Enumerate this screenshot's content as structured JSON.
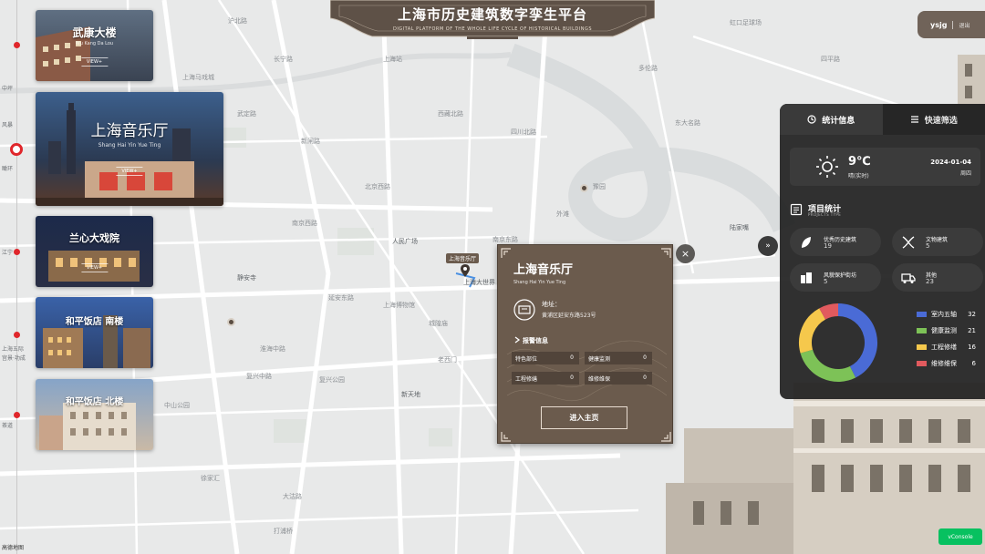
{
  "header": {
    "title": "上海市历史建筑数字孪生平台",
    "subtitle": "DIGITAL PLATFORM OF THE WHOLE LIFE CYCLE OF HISTORICAL BUILDINGS"
  },
  "user": {
    "name": "ysjg",
    "logout": "退出"
  },
  "timeline_labels": [
    "中坪",
    "风暴",
    "瞰环",
    "江宁",
    "上海五际",
    "宫景·功成",
    "茶道"
  ],
  "cards": [
    {
      "name": "武康大楼",
      "sub": "Wu Kang Da Lou",
      "view": "VIEW+"
    },
    {
      "name": "上海音乐厅",
      "sub": "Shang Hai Yin Yue Ting",
      "view": "VIEW+"
    },
    {
      "name": "兰心大戏院",
      "sub": "",
      "view": "VIEW+"
    },
    {
      "name": "和平饭店 南楼",
      "sub": "",
      "view": ""
    },
    {
      "name": "和平饭店 北楼",
      "sub": "",
      "view": ""
    }
  ],
  "map_labels": {
    "a": "沪北路",
    "b": "长宁路",
    "c": "武定路",
    "d": "新闸路",
    "e": "北京西路",
    "f": "南京西路",
    "g": "静安寺",
    "h": "延安东路",
    "i": "淮海中路",
    "j": "复兴中路",
    "k": "人民广场",
    "l": "上海大世界",
    "m": "新天地",
    "n": "老西门",
    "o": "四川北路",
    "p": "陆家嘴",
    "q": "外滩",
    "r": "豫园",
    "s": "上海马戏城",
    "t": "打浦桥",
    "u": "南京东路",
    "v": "豫园",
    "w": "西藏北路",
    "x": "上海站",
    "y": "大沽路",
    "z": "中山公园",
    "aa": "徐家汇",
    "ab": "复兴公园",
    "ac": "东大名路",
    "ad": "城隍庙",
    "ae": "上海博物馆",
    "af": "虹口足球场",
    "ag": "多伦路",
    "ah": "四平路",
    "pin": "上海音乐厅"
  },
  "panel": {
    "tab_stats": "统计信息",
    "tab_filter": "快速筛选",
    "weather": {
      "temp": "9℃",
      "desc": "晴(实时)",
      "date": "2024-01-04",
      "weekday": "周四"
    },
    "section_title": "项目统计",
    "section_sub": "PROJECTS TYPE",
    "stats": [
      {
        "name": "优秀历史建筑",
        "value": "19"
      },
      {
        "name": "文物建筑",
        "value": "5"
      },
      {
        "name": "风貌保护街坊",
        "value": "5"
      },
      {
        "name": "其他",
        "value": "23"
      }
    ],
    "colors": {
      "blue": "#4a6bd6",
      "green": "#7dc257",
      "yellow": "#f5c84c",
      "red": "#e15a5e"
    }
  },
  "chart_data": {
    "type": "pie",
    "categories": [
      "室内五轴",
      "健康监测",
      "工程修缮",
      "维修维保"
    ],
    "values": [
      32,
      21,
      16,
      6
    ],
    "title": "",
    "legend": "right"
  },
  "popup": {
    "title": "上海音乐厅",
    "en": "Shang Hai Yin Yue Ting",
    "addr_label": "地址：",
    "addr": "黄浦区延安东路523号",
    "warn_title": "报警信息",
    "items": [
      {
        "label": "特色部位",
        "value": "0"
      },
      {
        "label": "健康监测",
        "value": "0"
      },
      {
        "label": "工程修缮",
        "value": "0"
      },
      {
        "label": "维修维保",
        "value": "0"
      }
    ],
    "button": "进入主页",
    "close": "×"
  },
  "misc": {
    "vconsole": "vConsole",
    "amap": "高德地图",
    "arrow": "»"
  }
}
